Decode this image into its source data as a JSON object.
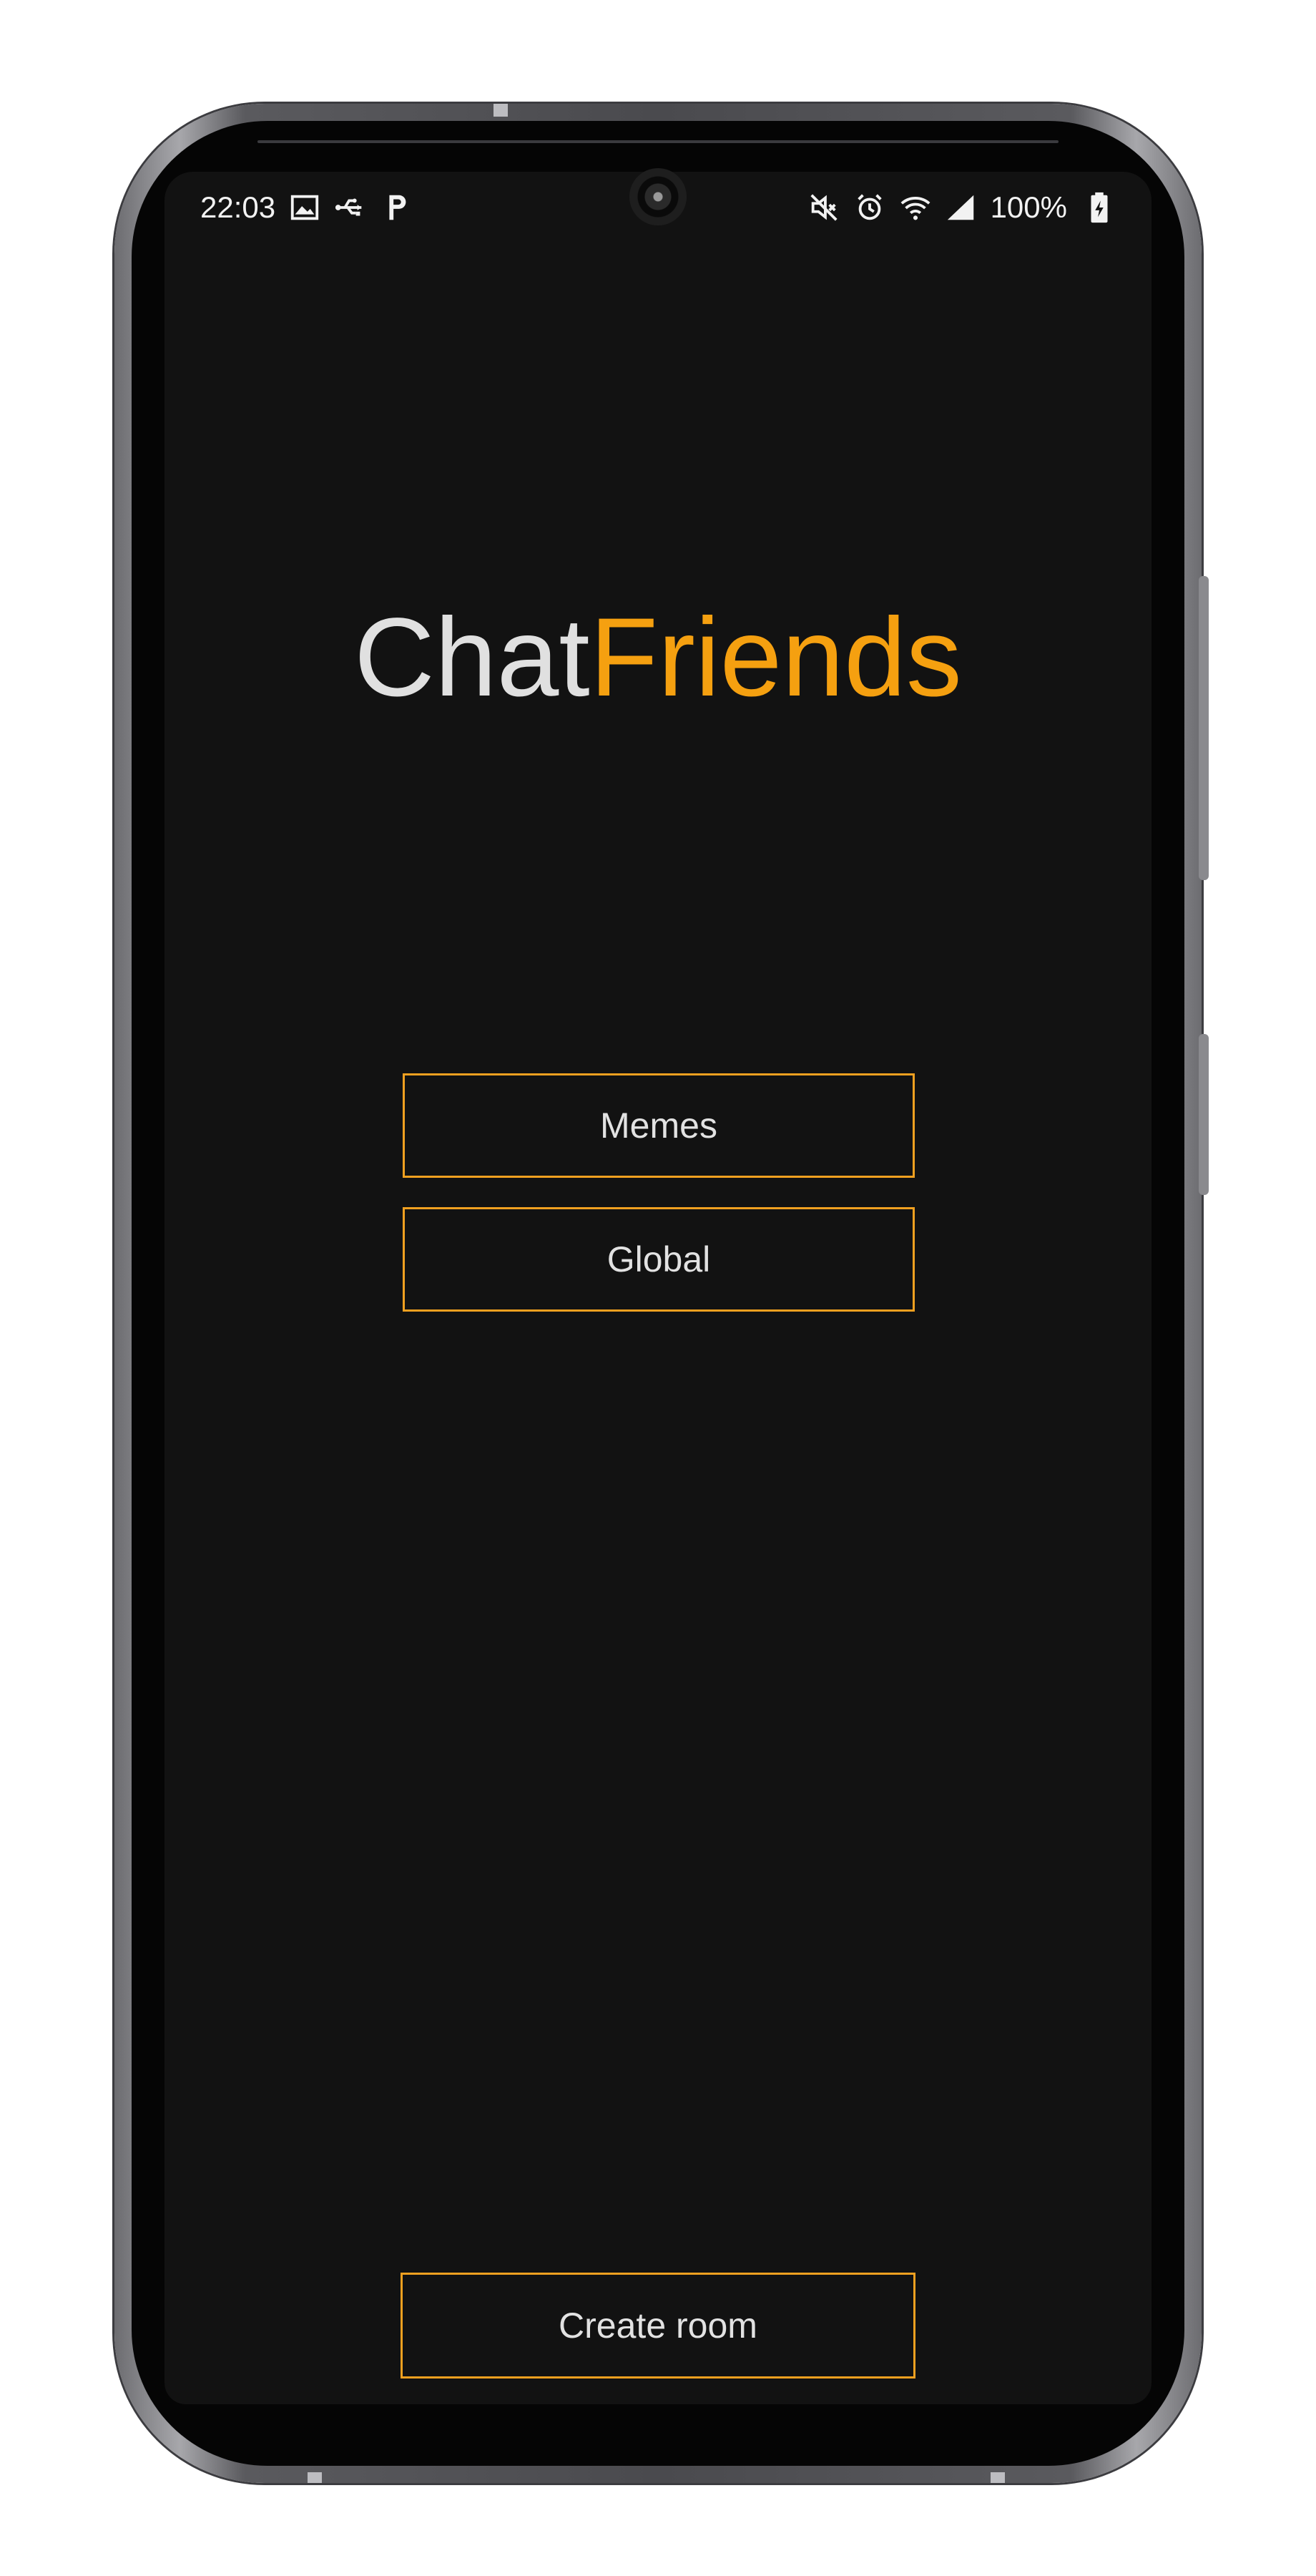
{
  "status_bar": {
    "time": "22:03",
    "left_icons": [
      "gallery-icon",
      "usb-icon",
      "p-app-icon"
    ],
    "right_icons": [
      "mute-icon",
      "alarm-icon",
      "wifi-icon",
      "signal-icon",
      "battery-icon"
    ],
    "battery_percent": "100%"
  },
  "app": {
    "title_part1": "Chat",
    "title_part2": "Friends",
    "accent_color": "#f5a010",
    "background_color": "#121212"
  },
  "rooms": [
    {
      "label": "Memes"
    },
    {
      "label": "Global"
    }
  ],
  "footer": {
    "create_room_label": "Create room"
  }
}
